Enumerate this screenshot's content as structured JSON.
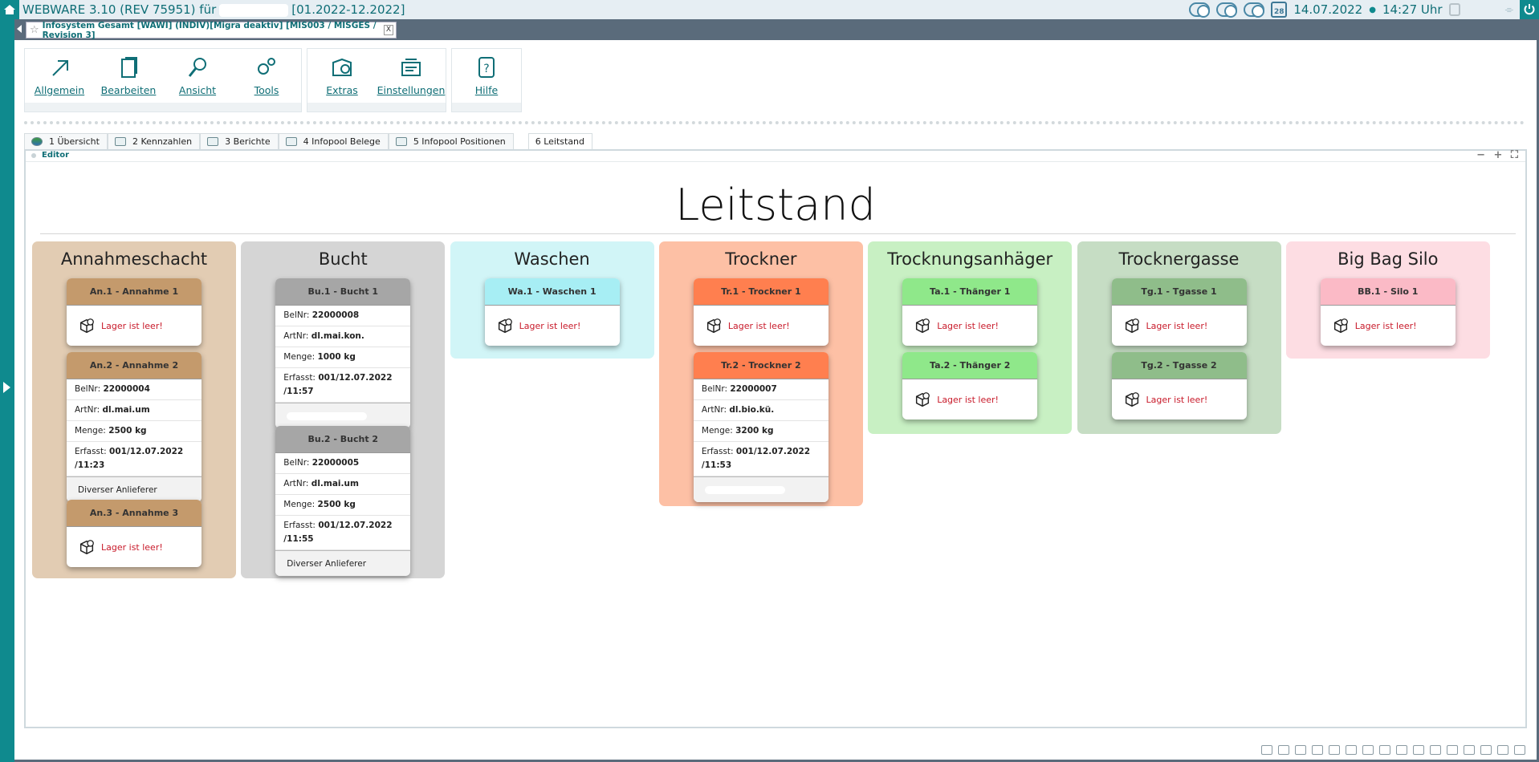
{
  "titlebar": {
    "app": "WEBWARE 3.10 (REV 75951) für",
    "range": "[01.2022-12.2022]",
    "date": "14.07.2022",
    "time": "14:27 Uhr",
    "calendar_day": "28"
  },
  "doc_tab": {
    "title": "Infosystem Gesamt [WAWI] (INDIV)[Migra deaktiv] [MIS003 / MISGES / Revision 3]",
    "close": "X"
  },
  "ribbon": {
    "groups": [
      [
        {
          "label": "Allgemein",
          "icon": "arrow-icon"
        },
        {
          "label": "Bearbeiten",
          "icon": "document-icon"
        },
        {
          "label": "Ansicht",
          "icon": "magnifier-icon"
        },
        {
          "label": "Tools",
          "icon": "gears-icon"
        }
      ],
      [
        {
          "label": "Extras",
          "icon": "extras-icon"
        },
        {
          "label": "Einstellungen",
          "icon": "settings-icon"
        }
      ],
      [
        {
          "label": "Hilfe",
          "icon": "help-icon"
        }
      ]
    ]
  },
  "subtabs": [
    "1 Übersicht",
    "2 Kennzahlen",
    "3 Berichte",
    "4 Infopool Belege",
    "5 Infopool Positionen",
    "6 Leitstand"
  ],
  "panel": {
    "label": "Editor",
    "controls": "− + ⛶"
  },
  "page_title": "Leitstand",
  "empty_text": "Lager ist leer!",
  "labels": {
    "belnr": "BelNr:",
    "artnr": "ArtNr:",
    "menge": "Menge:",
    "erfasst": "Erfasst:"
  },
  "lanes": [
    {
      "title": "Annahmeschacht",
      "bg": "#e2ccb3",
      "head": "#c49a6c",
      "cards": [
        {
          "title": "An.1 - Annahme 1",
          "empty": true
        },
        {
          "title": "An.2 - Annahme 2",
          "belnr": "22000004",
          "artnr": "dl.mai.um",
          "menge": "2500 kg",
          "erfasst": "001/12.07.2022 /11:23",
          "foot": "Diverser Anlieferer"
        },
        {
          "title": "An.3 - Annahme 3",
          "empty": true
        }
      ]
    },
    {
      "title": "Bucht",
      "bg": "#d5d5d5",
      "head": "#a6a6a6",
      "cards": [
        {
          "title": "Bu.1 - Bucht 1",
          "belnr": "22000008",
          "artnr": "dl.mai.kon.",
          "menge": "1000 kg",
          "erfasst": "001/12.07.2022 /11:57",
          "foot": ""
        },
        {
          "title": "Bu.2 - Bucht 2",
          "belnr": "22000005",
          "artnr": "dl.mai.um",
          "menge": "2500 kg",
          "erfasst": "001/12.07.2022 /11:55",
          "foot": "Diverser Anlieferer"
        }
      ]
    },
    {
      "title": "Waschen",
      "bg": "#d1f5f7",
      "head": "#a7eef4",
      "cards": [
        {
          "title": "Wa.1 - Waschen 1",
          "empty": true
        }
      ]
    },
    {
      "title": "Trockner",
      "bg": "#fdc0a5",
      "head": "#ff7f4f",
      "cards": [
        {
          "title": "Tr.1 - Trockner 1",
          "empty": true
        },
        {
          "title": "Tr.2 - Trockner 2",
          "belnr": "22000007",
          "artnr": "dl.bio.kü.",
          "menge": "3200 kg",
          "erfasst": "001/12.07.2022 /11:53",
          "foot": ""
        }
      ]
    },
    {
      "title": "Trocknungsanhäger",
      "bg": "#c8f0c3",
      "head": "#8fe88a",
      "cards": [
        {
          "title": "Ta.1 - Thänger 1",
          "empty": true
        },
        {
          "title": "Ta.2 - Thänger 2",
          "empty": true
        }
      ]
    },
    {
      "title": "Trocknergasse",
      "bg": "#c6ddc4",
      "head": "#8fbd8a",
      "cards": [
        {
          "title": "Tg.1 - Tgasse 1",
          "empty": true
        },
        {
          "title": "Tg.2 - Tgasse 2",
          "empty": true
        }
      ]
    },
    {
      "title": "Big Bag Silo",
      "bg": "#fddde3",
      "head": "#fbbac6",
      "cards": [
        {
          "title": "BB.1 - Silo 1",
          "empty": true
        }
      ]
    }
  ]
}
